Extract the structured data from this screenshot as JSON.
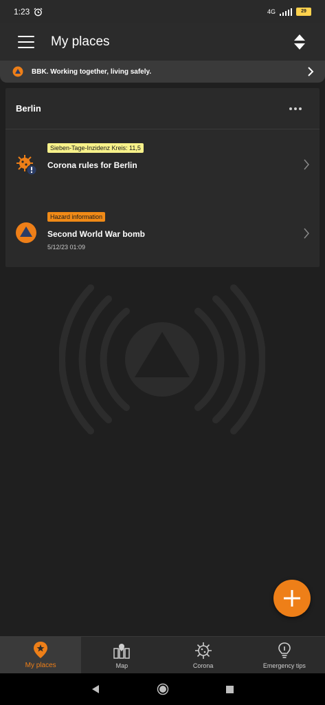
{
  "status_bar": {
    "time": "1:23",
    "network": "4G",
    "battery": "29"
  },
  "app_bar": {
    "title": "My places"
  },
  "banner": {
    "text": "BBK. Working together, living safely."
  },
  "place": {
    "name": "Berlin",
    "items": [
      {
        "badge": "Sieben-Tage-Inzidenz Kreis: 11,5",
        "title": "Corona rules for Berlin",
        "time": ""
      },
      {
        "badge": "Hazard information",
        "title": "Second World War bomb",
        "time": "5/12/23 01:09"
      }
    ]
  },
  "bottom_nav": [
    {
      "label": "My places",
      "icon": "location-star-icon",
      "active": true
    },
    {
      "label": "Map",
      "icon": "map-icon",
      "active": false
    },
    {
      "label": "Corona",
      "icon": "virus-icon",
      "active": false
    },
    {
      "label": "Emergency tips",
      "icon": "lightbulb-icon",
      "active": false
    }
  ],
  "colors": {
    "accent": "#ee7f18",
    "badge_yellow": "#f7f18a",
    "badge_orange": "#f08a17",
    "background": "#1f1f1f"
  }
}
